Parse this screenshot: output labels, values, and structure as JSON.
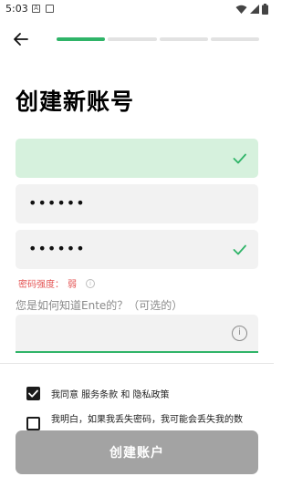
{
  "status_bar": {
    "time": "5:03",
    "icons": [
      "notification-a-icon",
      "notification-box-icon",
      "wifi-icon",
      "cellular-signal-icon",
      "battery-icon"
    ]
  },
  "header": {
    "back_icon": "arrow-left-icon",
    "progress": {
      "total_steps": 4,
      "current_step": 1
    }
  },
  "title": "创建新账号",
  "form": {
    "email": {
      "value": "",
      "valid": true
    },
    "password": {
      "value": "••••••",
      "valid": false
    },
    "confirm_password": {
      "value": "••••••",
      "valid": true
    },
    "strength": {
      "label": "密码强度：",
      "value": "弱"
    },
    "source": {
      "label": "您是如何知道Ente的？（可选的）",
      "value": ""
    }
  },
  "agreements": {
    "terms": "我同意 服务条款 和 隐私政策",
    "terms_checked": true,
    "warning": "我明白，如果我丢失密码，我可能会丢失我的数",
    "warning_checked": false
  },
  "create_button": "创建账户",
  "colors": {
    "accent": "#2fb468",
    "valid_field": "#d6f1dd",
    "field": "#f2f2f2",
    "error": "#e45454",
    "button_disabled": "#a3a3a3"
  }
}
